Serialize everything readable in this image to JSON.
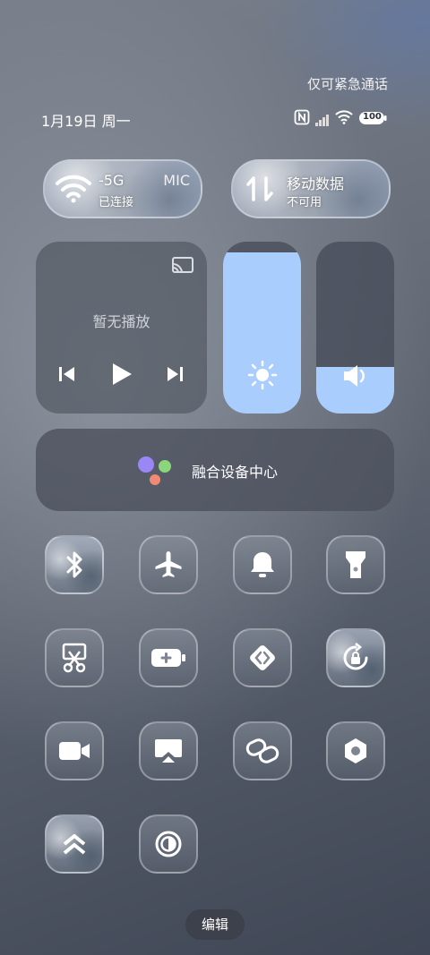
{
  "status_bar": {
    "emergency_text": "仅可紧急通话",
    "date": "1月19日 周一",
    "battery": "100",
    "icons": [
      "nfc-icon",
      "signal-icon",
      "wifi-icon",
      "battery-icon"
    ]
  },
  "connectivity": {
    "wifi": {
      "title": "-5G",
      "title_extra": "MIC",
      "status": "已连接",
      "icon": "wifi-icon"
    },
    "mobile_data": {
      "title": "移动数据",
      "status": "不可用",
      "icon": "data-arrows-icon"
    }
  },
  "media": {
    "now_playing": "暂无播放",
    "controls": [
      "previous-icon",
      "play-icon",
      "next-icon"
    ],
    "cast_icon": "cast-icon"
  },
  "sliders": {
    "brightness_level": 0.94,
    "volume_level": 0.27,
    "accent_color": "#a9cdfd"
  },
  "device_hub": {
    "label": "融合设备中心"
  },
  "tiles": [
    "bluetooth-icon",
    "airplane-icon",
    "bell-icon",
    "flashlight-icon",
    "screenshot-icon",
    "battery-saver-icon",
    "code-icon",
    "rotation-lock-icon",
    "video-icon",
    "screen-cast-icon",
    "link-icon",
    "settings-icon",
    "chevrons-up-icon",
    "contrast-icon"
  ],
  "footer": {
    "edit_label": "编辑"
  }
}
